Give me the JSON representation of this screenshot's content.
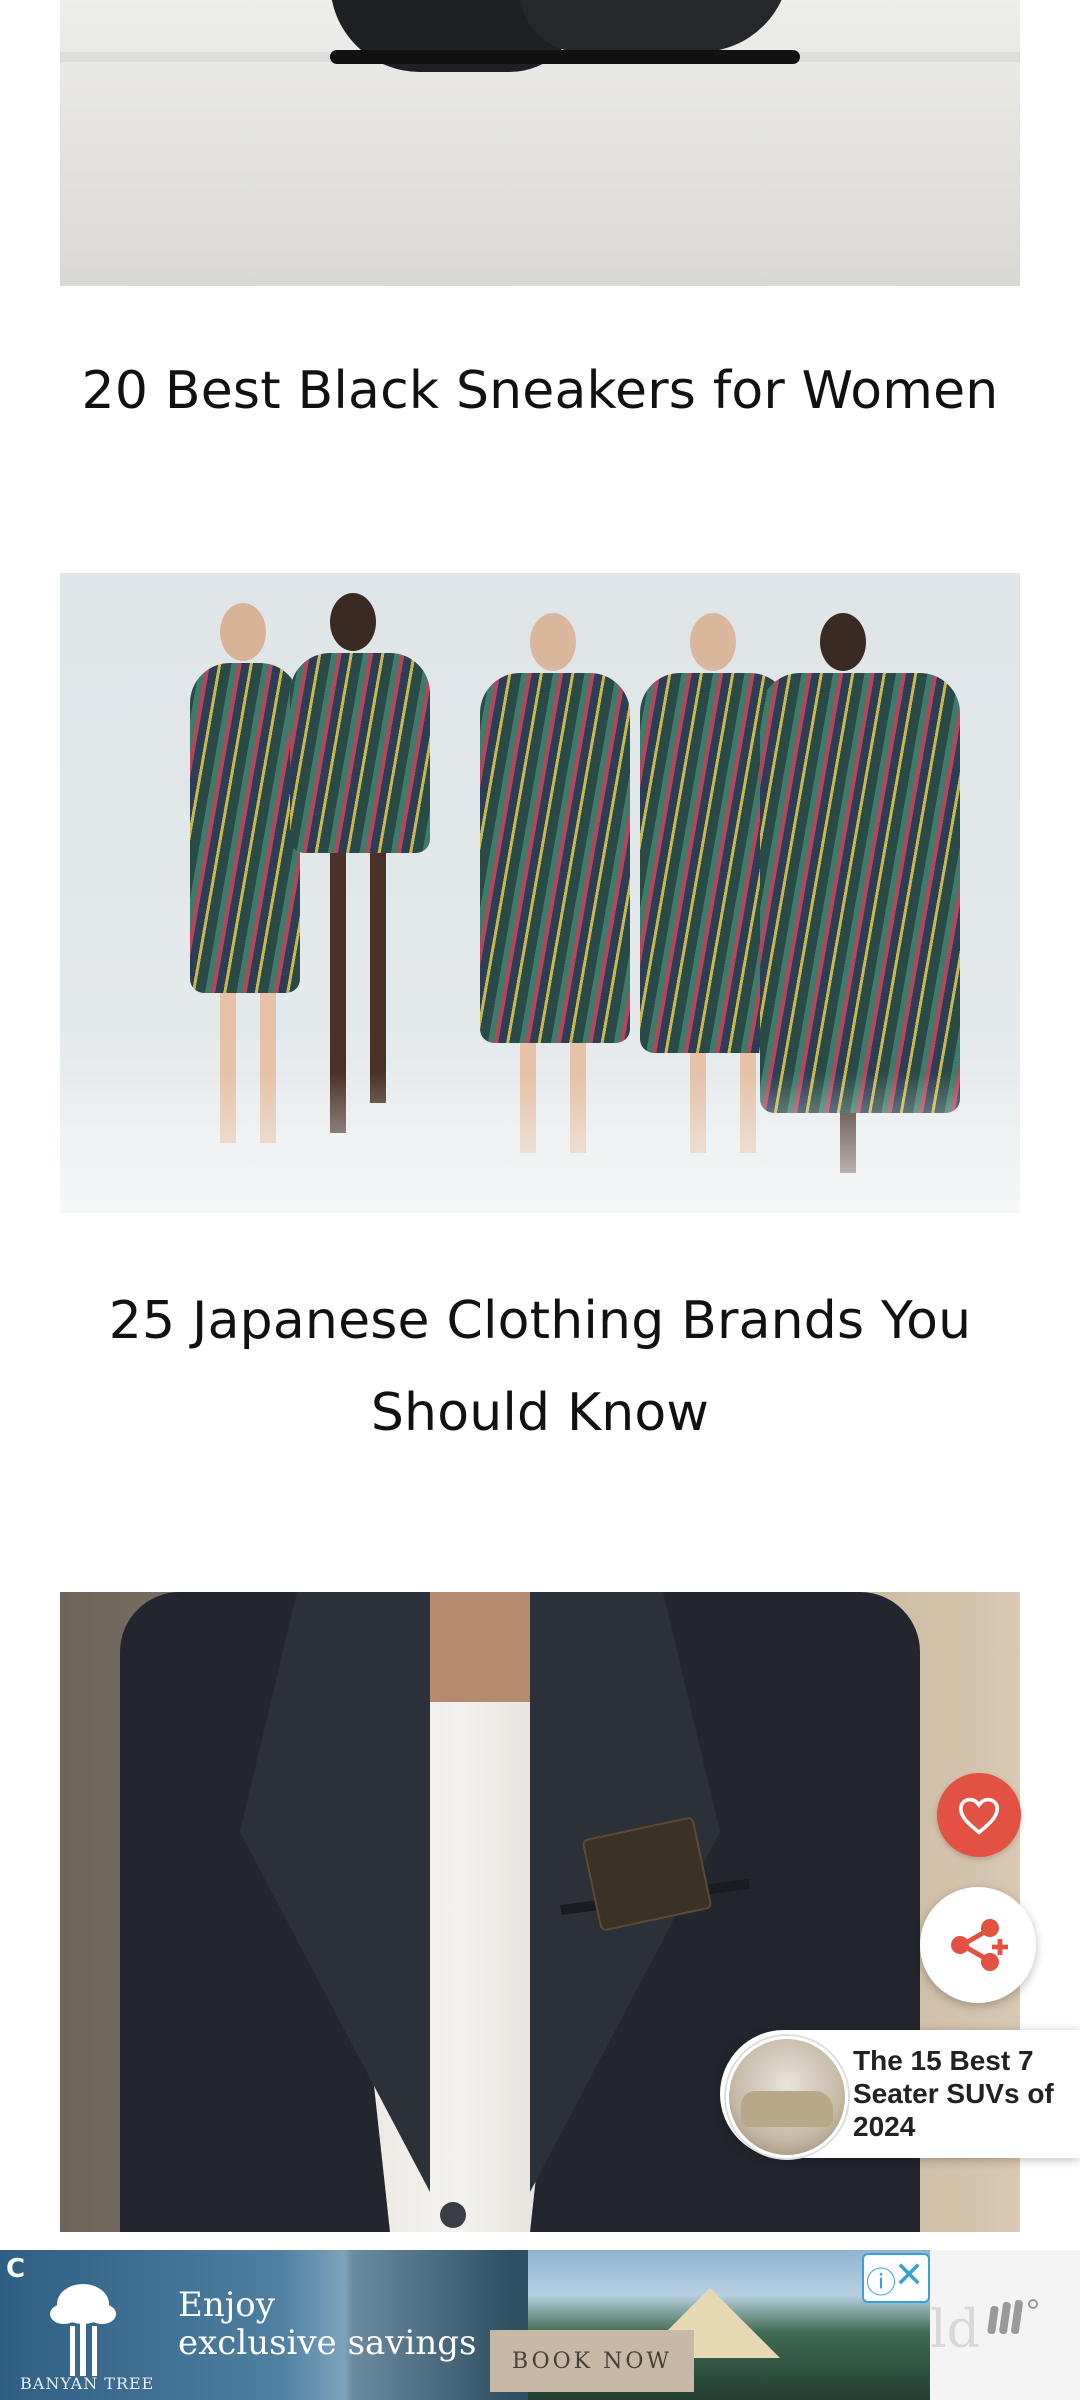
{
  "articles": [
    {
      "title": "20 Best Black Sneakers for Women",
      "image": "black-sneakers-photo"
    },
    {
      "title": "25 Japanese Clothing Brands You Should Know",
      "image": "japanese-fashion-dancers-photo"
    },
    {
      "title": "",
      "image": "suit-wallet-photo"
    }
  ],
  "floating": {
    "heart_icon": "heart-icon",
    "share_icon": "share-icon",
    "promo": {
      "text": "The 15 Best 7 Seater SUVs of 2024"
    }
  },
  "ad": {
    "brand": "BANYAN TREE",
    "headline_line1": "Enjoy",
    "headline_line2": "exclusive savings",
    "cta": "BOOK NOW",
    "corner_letter": "C",
    "info_glyph": "ⓘ",
    "close_glyph": "✕",
    "strip_text": "ld"
  },
  "colors": {
    "heart_bg": "#e25141",
    "share_icon": "#e25141",
    "ad_close": "#3aa0d8"
  }
}
